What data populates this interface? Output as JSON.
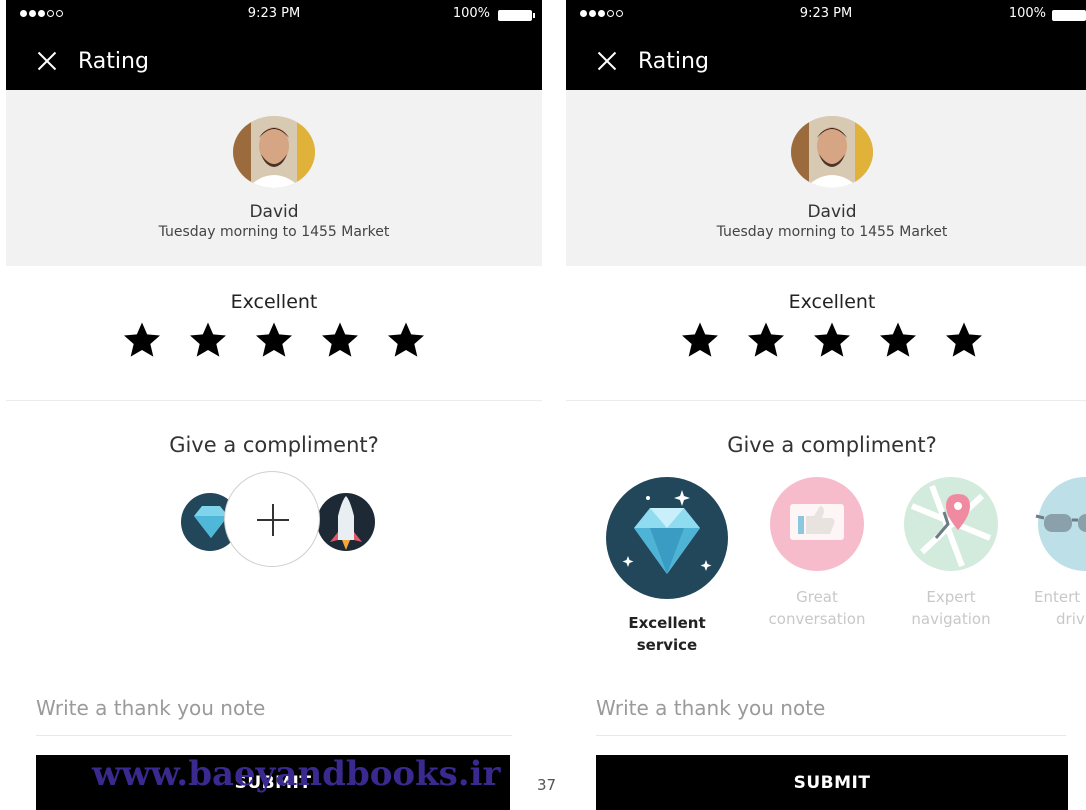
{
  "screens": {
    "left": {
      "status": {
        "time": "9:23 PM",
        "battery": "100%"
      },
      "header": {
        "title": "Rating"
      },
      "driver": {
        "name": "David",
        "trip": "Tuesday morning to 1455 Market"
      },
      "rating": {
        "label": "Excellent",
        "stars_selected": 5,
        "stars_total": 5
      },
      "compliment": {
        "title": "Give a compliment?"
      },
      "note": {
        "placeholder": "Write a thank you note"
      },
      "submit_label": "SUBMIT"
    },
    "right": {
      "status": {
        "time": "9:23 PM",
        "battery": "100%"
      },
      "header": {
        "title": "Rating"
      },
      "driver": {
        "name": "David",
        "trip": "Tuesday morning to 1455 Market"
      },
      "rating": {
        "label": "Excellent",
        "stars_selected": 5,
        "stars_total": 5
      },
      "compliment": {
        "title": "Give a compliment?",
        "badges": [
          {
            "line1": "Excellent",
            "line2": "service",
            "selected": true,
            "icon": "diamond-icon"
          },
          {
            "line1": "Great",
            "line2": "conversation",
            "selected": false,
            "icon": "thumbs-up-icon"
          },
          {
            "line1": "Expert",
            "line2": "navigation",
            "selected": false,
            "icon": "map-pin-icon"
          },
          {
            "line1": "Entert",
            "line2": "driv",
            "selected": false,
            "icon": "sunglasses-icon"
          }
        ]
      },
      "note": {
        "placeholder": "Write a thank you note"
      },
      "submit_label": "SUBMIT"
    }
  },
  "watermark": "www.baeyandbooks.ir",
  "page_number": "37",
  "colors": {
    "bar": "#000000",
    "panel": "#f2f2f2",
    "badge_navy": "#22475a",
    "badge_pink": "#f7b9c8",
    "badge_green": "#cfe7d6",
    "badge_teal": "#b9dde6"
  }
}
